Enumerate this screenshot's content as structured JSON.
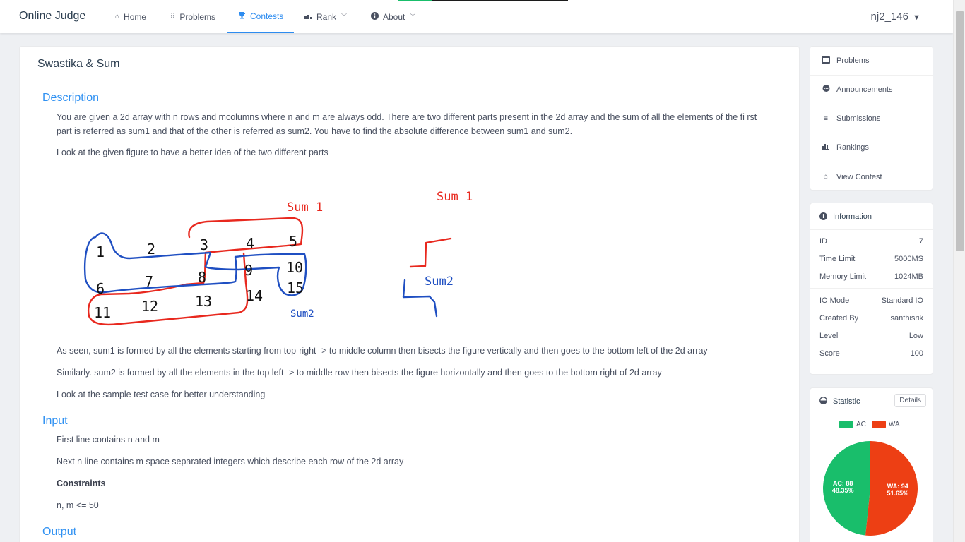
{
  "app": {
    "logo": "Online Judge"
  },
  "nav": [
    {
      "label": "Home",
      "icon": "home-icon",
      "glyph": "⌂"
    },
    {
      "label": "Problems",
      "icon": "grid-icon",
      "glyph": "⠿"
    },
    {
      "label": "Contests",
      "icon": "trophy-icon",
      "glyph": "🏆"
    },
    {
      "label": "Rank",
      "icon": "bar-chart-icon",
      "glyph": "▂▄"
    },
    {
      "label": "About",
      "icon": "info-icon",
      "glyph": "❶"
    }
  ],
  "user": {
    "name": "nj2_146"
  },
  "problem": {
    "title": "Swastika & Sum",
    "description_heading": "Description",
    "desc_p1": "You are given a 2d array with n  rows and mcolumns where n and m are always odd. There are two different parts present in the 2d array and the sum of all the elements of the fi rst part is referred as sum1 and that of the other is referred as sum2. You have to find the absolute difference between sum1 and sum2.",
    "desc_p2": "Look at the given figure to have a better idea of the two different parts",
    "desc_p3": "As seen, sum1 is formed by all the elements starting from top-right -> to middle column then bisects the figure vertically and then goes to the bottom left of the 2d array",
    "desc_p4": "Similarly. sum2 is formed by all the elements in the top left -> to middle row then bisects the figure horizontally and then goes to the bottom right of 2d array",
    "desc_p5": "Look at the sample test case for better understanding",
    "input_heading": "Input",
    "input_p1": "First line contains n and m",
    "input_p2": "Next n line contains m space separated integers which describe each row of the 2d array",
    "constraints_label": "Constraints",
    "constraints_value": "n, m <= 50",
    "output_heading": "Output"
  },
  "figure": {
    "grid_numbers": [
      "1",
      "2",
      "3",
      "4",
      "5",
      "6",
      "7",
      "8",
      "9",
      "10",
      "11",
      "12",
      "13",
      "14",
      "15"
    ],
    "label_sum1": "Sum 1",
    "label_sum2": "Sum2",
    "label_shape_sum1": "Sum 1",
    "label_shape_sum2": "Sum2",
    "color_sum1": "#e8281e",
    "color_sum2": "#1f4fc2"
  },
  "side_menu": [
    {
      "label": "Problems",
      "icon": "book-icon",
      "glyph": "▣"
    },
    {
      "label": "Announcements",
      "icon": "chat-icon",
      "glyph": "●"
    },
    {
      "label": "Submissions",
      "icon": "list-icon",
      "glyph": "≡"
    },
    {
      "label": "Rankings",
      "icon": "bar-chart-icon",
      "glyph": "▂▄"
    },
    {
      "label": "View Contest",
      "icon": "home-icon",
      "glyph": "⌂"
    }
  ],
  "information": {
    "heading": "Information",
    "rows": [
      {
        "label": "ID",
        "value": "7"
      },
      {
        "label": "Time Limit",
        "value": "5000MS"
      },
      {
        "label": "Memory Limit",
        "value": "1024MB"
      },
      {
        "label": "IO Mode",
        "value": "Standard IO"
      },
      {
        "label": "Created By",
        "value": "santhisrik"
      },
      {
        "label": "Level",
        "value": "Low"
      },
      {
        "label": "Score",
        "value": "100"
      }
    ]
  },
  "statistic": {
    "heading": "Statistic",
    "details_label": "Details",
    "legend": [
      {
        "label": "AC",
        "color": "#19be6b"
      },
      {
        "label": "WA",
        "color": "#ed3f14"
      }
    ],
    "slices": [
      {
        "label_top": "AC: 88",
        "label_bottom": "48.35%",
        "value": 88,
        "color": "#19be6b"
      },
      {
        "label_top": "WA: 94",
        "label_bottom": "51.65%",
        "value": 94,
        "color": "#ed3f14"
      }
    ]
  },
  "chart_data": {
    "type": "pie",
    "categories": [
      "AC",
      "WA"
    ],
    "values": [
      88,
      94
    ],
    "percentages": [
      48.35,
      51.65
    ],
    "legend_placement": "top"
  }
}
